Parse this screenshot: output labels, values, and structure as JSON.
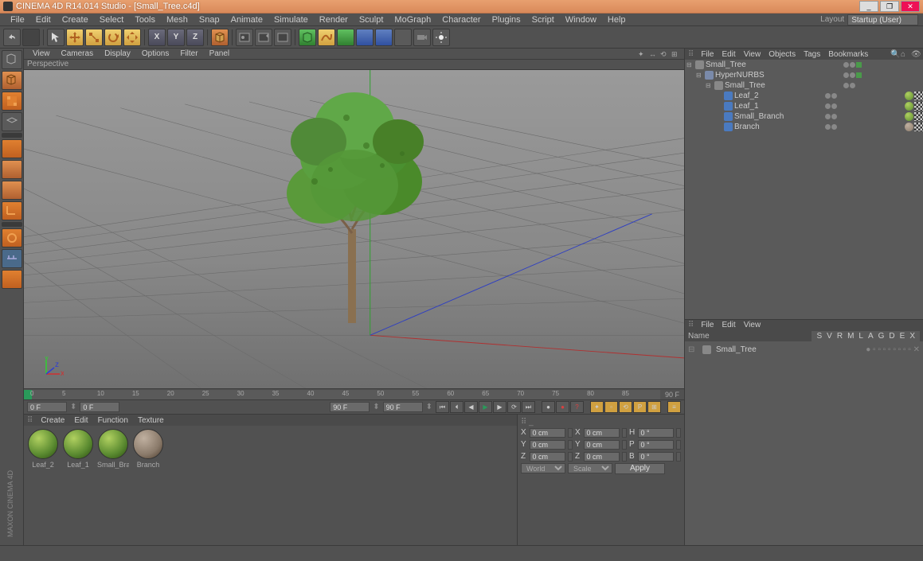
{
  "titlebar": {
    "text": "CINEMA 4D R14.014 Studio - [Small_Tree.c4d]"
  },
  "menubar": {
    "items": [
      "File",
      "Edit",
      "Create",
      "Select",
      "Tools",
      "Mesh",
      "Snap",
      "Animate",
      "Simulate",
      "Render",
      "Sculpt",
      "MoGraph",
      "Character",
      "Plugins",
      "Script",
      "Window",
      "Help"
    ],
    "layout_label": "Layout",
    "layout_value": "Startup (User)"
  },
  "viewport_menu": {
    "items": [
      "View",
      "Cameras",
      "Display",
      "Options",
      "Filter",
      "Panel"
    ],
    "label": "Perspective"
  },
  "timeline": {
    "start": 0,
    "end": 90,
    "ticks": [
      0,
      5,
      10,
      15,
      20,
      25,
      30,
      35,
      40,
      45,
      50,
      55,
      60,
      65,
      70,
      75,
      80,
      85,
      90
    ],
    "start_label": "0 F",
    "end_label": "90 F"
  },
  "transport": {
    "cur_frame": "0 F",
    "field2": "0 F",
    "field3": "90 F",
    "field4": "90 F"
  },
  "materials": {
    "menu": [
      "Create",
      "Edit",
      "Function",
      "Texture"
    ],
    "items": [
      {
        "name": "Leaf_2",
        "type": "leaf"
      },
      {
        "name": "Leaf_1",
        "type": "leaf"
      },
      {
        "name": "Small_Bran",
        "type": "leaf"
      },
      {
        "name": "Branch",
        "type": "branch"
      }
    ]
  },
  "coords": {
    "rows": [
      {
        "l1": "X",
        "v1": "0 cm",
        "l2": "X",
        "v2": "0 cm",
        "l3": "H",
        "v3": "0 °"
      },
      {
        "l1": "Y",
        "v1": "0 cm",
        "l2": "Y",
        "v2": "0 cm",
        "l3": "P",
        "v3": "0 °"
      },
      {
        "l1": "Z",
        "v1": "0 cm",
        "l2": "Z",
        "v2": "0 cm",
        "l3": "B",
        "v3": "0 °"
      }
    ],
    "sel1": "World",
    "sel2": "Scale",
    "apply": "Apply"
  },
  "obj_manager": {
    "menu": [
      "File",
      "Edit",
      "View",
      "Objects",
      "Tags",
      "Bookmarks"
    ],
    "tree": [
      {
        "indent": 0,
        "icon": "null",
        "name": "Small_Tree",
        "expand": "⊟",
        "mats": []
      },
      {
        "indent": 1,
        "icon": "hn",
        "name": "HyperNURBS",
        "expand": "⊟",
        "mats": []
      },
      {
        "indent": 2,
        "icon": "null",
        "name": "Small_Tree",
        "expand": "⊟",
        "mats": []
      },
      {
        "indent": 3,
        "icon": "poly",
        "name": "Leaf_2",
        "expand": "",
        "mats": [
          "leaf",
          "sq"
        ]
      },
      {
        "indent": 3,
        "icon": "poly",
        "name": "Leaf_1",
        "expand": "",
        "mats": [
          "leaf",
          "sq"
        ]
      },
      {
        "indent": 3,
        "icon": "poly",
        "name": "Small_Branch",
        "expand": "",
        "mats": [
          "leaf",
          "sq"
        ]
      },
      {
        "indent": 3,
        "icon": "poly",
        "name": "Branch",
        "expand": "",
        "mats": [
          "branch",
          "sq"
        ]
      }
    ]
  },
  "attr_manager": {
    "menu": [
      "File",
      "Edit",
      "View"
    ],
    "tabs": [
      "S",
      "V",
      "R",
      "M",
      "L",
      "A",
      "G",
      "D",
      "E",
      "X"
    ],
    "name_label": "Name",
    "name_value": "Small_Tree"
  },
  "logo": "MAXON  CINEMA 4D"
}
